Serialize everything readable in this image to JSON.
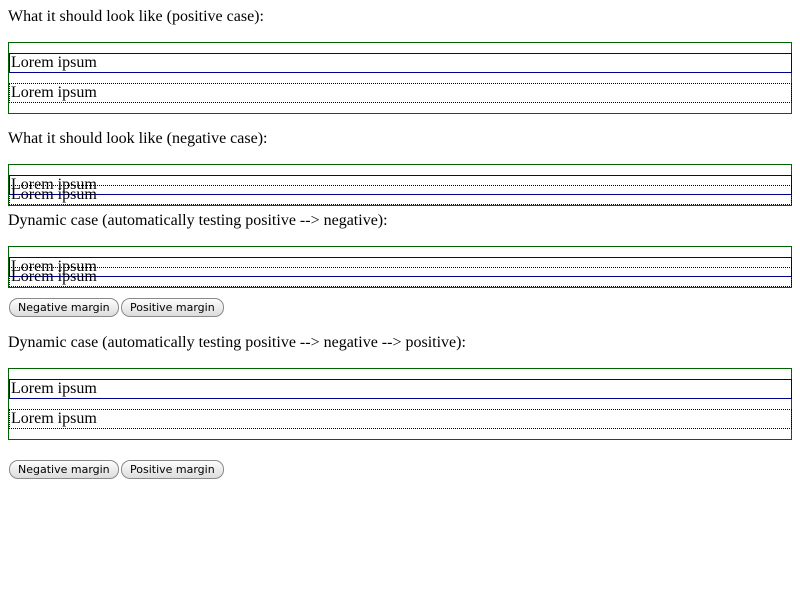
{
  "sections": [
    {
      "heading": "What it should look like (positive case):",
      "box1_text": "Lorem ipsum",
      "box2_text": "Lorem ipsum"
    },
    {
      "heading": "What it should look like (negative case):",
      "box1_text": "Lorem ipsum",
      "box2_text": "Lorem ipsum"
    },
    {
      "heading": "Dynamic case (automatically testing positive --> negative):",
      "box1_text": "Lorem ipsum",
      "box2_text": "Lorem ipsum",
      "buttons": {
        "negative": "Negative margin",
        "positive": "Positive margin"
      }
    },
    {
      "heading": "Dynamic case (automatically testing positive --> negative --> positive):",
      "box1_text": "Lorem ipsum",
      "box2_text": "Lorem ipsum",
      "buttons": {
        "negative": "Negative margin",
        "positive": "Positive margin"
      }
    }
  ]
}
